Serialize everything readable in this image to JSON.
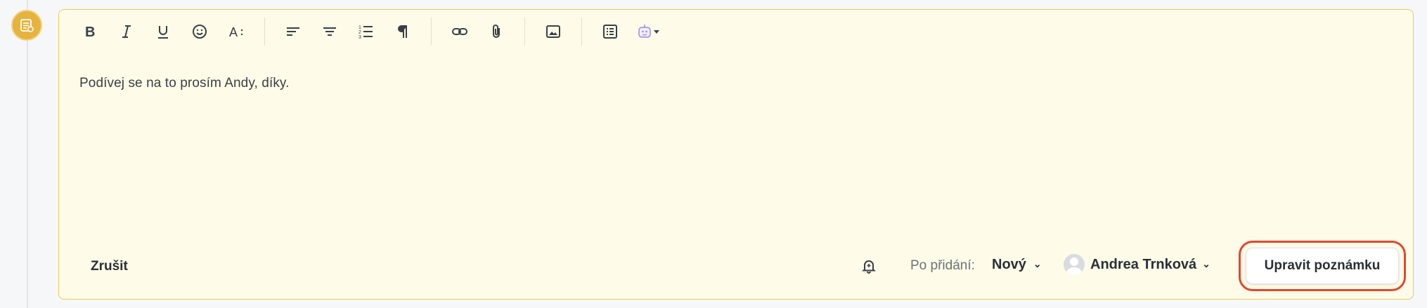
{
  "toolbar": {
    "groups": [
      [
        "bold-icon",
        "italic-icon",
        "underline-icon",
        "emoji-icon",
        "font-size-icon"
      ],
      [
        "align-left-icon",
        "align-center-icon",
        "numbered-list-icon",
        "paragraph-icon"
      ],
      [
        "link-icon",
        "attachment-icon"
      ],
      [
        "image-icon"
      ],
      [
        "table-icon",
        "ai-assistant-icon"
      ]
    ]
  },
  "editor": {
    "text": "Podívej se na to prosím Andy, díky."
  },
  "footer": {
    "cancel_label": "Zrušit",
    "after_add_label": "Po přidání:",
    "status_value": "Nový",
    "assignee_name": "Andrea Trnková",
    "submit_label": "Upravit poznámku"
  },
  "colors": {
    "editor_bg": "#fefce8",
    "editor_border": "#efc75e",
    "badge": "#e5b33e",
    "highlight_ring": "#e5462e"
  }
}
